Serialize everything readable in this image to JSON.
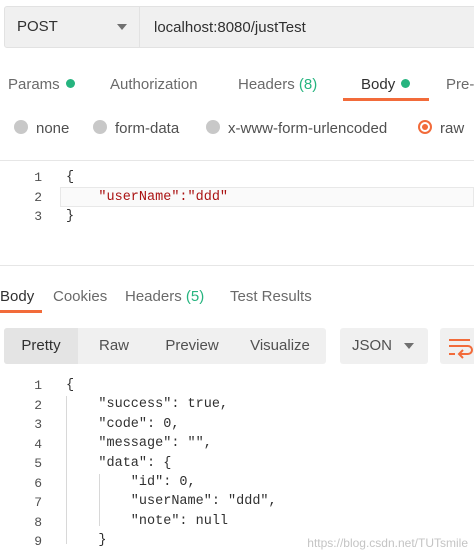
{
  "request": {
    "method": "POST",
    "url": "localhost:8080/justTest"
  },
  "request_tabs": [
    {
      "label": "Params",
      "dot": true
    },
    {
      "label": "Authorization"
    },
    {
      "label": "Headers",
      "count": "(8)"
    },
    {
      "label": "Body",
      "dot": true,
      "active": true
    },
    {
      "label": "Pre-"
    }
  ],
  "body_types": [
    {
      "label": "none"
    },
    {
      "label": "form-data"
    },
    {
      "label": "x-www-form-urlencoded"
    },
    {
      "label": "raw",
      "selected": true
    }
  ],
  "request_body": {
    "line_numbers": [
      "1",
      "2",
      "3"
    ],
    "lines": [
      "{",
      "    \"userName\":\"ddd\"",
      "}"
    ]
  },
  "response_tabs": [
    {
      "label": "Body",
      "active": true
    },
    {
      "label": "Cookies"
    },
    {
      "label": "Headers",
      "count": "(5)"
    },
    {
      "label": "Test Results"
    }
  ],
  "view_modes": [
    "Pretty",
    "Raw",
    "Preview",
    "Visualize"
  ],
  "active_view": "Pretty",
  "format": "JSON",
  "wrap_icon": "wrap-lines-icon",
  "response_body": {
    "line_numbers": [
      "1",
      "2",
      "3",
      "4",
      "5",
      "6",
      "7",
      "8",
      "9"
    ],
    "lines": [
      "{",
      "    \"success\": true,",
      "    \"code\": 0,",
      "    \"message\": \"\",",
      "    \"data\": {",
      "        \"id\": 0,",
      "        \"userName\": \"ddd\",",
      "        \"note\": null",
      "    }"
    ]
  },
  "watermark": "https://blog.csdn.net/TUTsmile",
  "colors": {
    "accent": "#f26b3a",
    "dot_green": "#26b47f"
  }
}
